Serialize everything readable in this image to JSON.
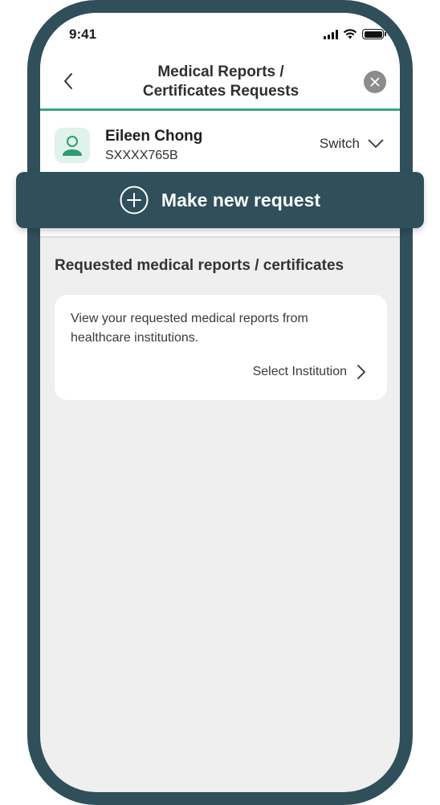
{
  "status_bar": {
    "time": "9:41"
  },
  "header": {
    "title_line1": "Medical Reports /",
    "title_line2": "Certificates Requests"
  },
  "profile": {
    "name": "Eileen Chong",
    "id": "SXXXX765B",
    "switch_label": "Switch"
  },
  "cta": {
    "label": "Make new request"
  },
  "section": {
    "title": "Requested medical reports / certificates",
    "card_text": "View your requested medical reports from healthcare institutions.",
    "link_label": "Select Institution"
  },
  "colors": {
    "frame": "#2f4f5a",
    "accent_green": "#3aa57a",
    "avatar_bg": "#dff3ea",
    "background": "#efefef"
  },
  "icons": [
    "back-chevron-icon",
    "close-icon",
    "user-icon",
    "chevron-down-icon",
    "plus-circle-icon",
    "chevron-right-icon",
    "signal-icon",
    "wifi-icon",
    "battery-icon"
  ]
}
